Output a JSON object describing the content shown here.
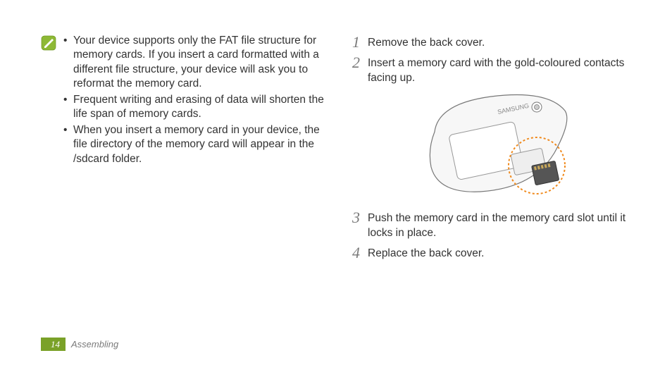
{
  "note": {
    "bullets": [
      "Your device supports only the FAT file structure for memory cards. If you insert a card formatted with a different file structure, your device will ask you to reformat the memory card.",
      "Frequent writing and erasing of data will shorten the life span of memory cards.",
      "When you insert a memory card in your device, the file directory of the memory card will appear in the /sdcard folder."
    ]
  },
  "steps": [
    {
      "num": "1",
      "text": "Remove the back cover."
    },
    {
      "num": "2",
      "text": "Insert a memory card with the gold-coloured contacts facing up."
    },
    {
      "num": "3",
      "text": "Push the memory card in the memory card slot until it locks in place."
    },
    {
      "num": "4",
      "text": "Replace the back cover."
    }
  ],
  "footer": {
    "page": "14",
    "section": "Assembling"
  }
}
